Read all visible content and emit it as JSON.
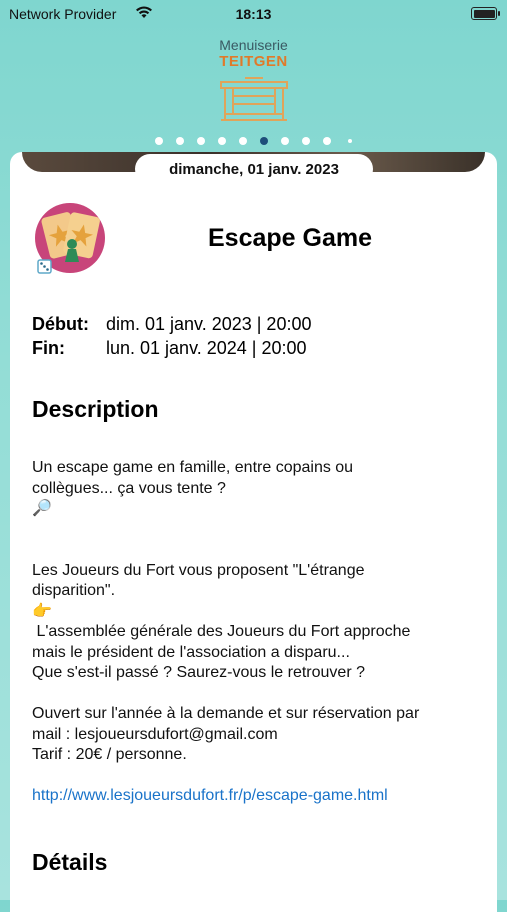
{
  "status_bar": {
    "carrier": "Network Provider",
    "time": "18:13"
  },
  "logo": {
    "top": "Menuiserie",
    "name": "TEITGEN"
  },
  "carousel": {
    "count": 10,
    "active_index": 5
  },
  "event": {
    "date": "dimanche, 01 janv. 2023",
    "title": "Escape Game",
    "start_label": "Début:",
    "start_value": "dim. 01 janv. 2023 | 20:00",
    "end_label": "Fin:",
    "end_value": "lun. 01 janv. 2024 | 20:00"
  },
  "description": {
    "heading": "Description",
    "line1": "Un escape game en famille, entre copains ou",
    "line2": "collègues... ça vous tente ?",
    "emoji1": "🔎",
    "line3": "Les Joueurs du Fort vous proposent \"L'étrange",
    "line4": "disparition\".",
    "emoji2": "👉",
    "line5": " L'assemblée générale des Joueurs du Fort approche",
    "line6": "mais le président de l'association a disparu...",
    "line7": "Que s'est-il passé ? Saurez-vous le retrouver ?",
    "line8": "Ouvert sur l'année à la demande et sur réservation par",
    "line9": "mail : lesjoueursdufort@gmail.com",
    "line10": "Tarif : 20€ / personne.",
    "link": "http://www.lesjoueursdufort.fr/p/escape-game.html"
  },
  "details": {
    "heading": "Détails"
  },
  "icons": {
    "event": "board-game-icon",
    "wifi": "wifi-icon",
    "battery": "battery-icon"
  },
  "colors": {
    "accent": "#1a73c9",
    "logo_orange": "#e07a2a",
    "active_dot": "#1d4e7a"
  }
}
